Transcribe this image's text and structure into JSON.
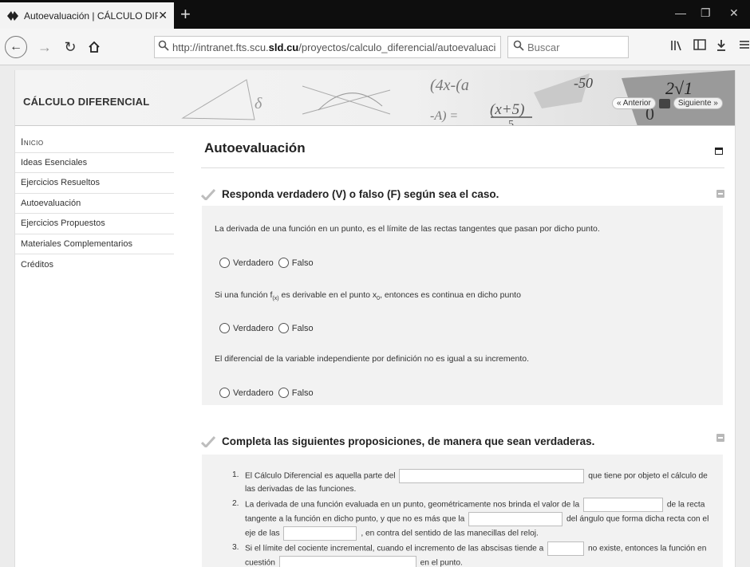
{
  "browser": {
    "tab_title": "Autoevaluación | CÁLCULO DIF",
    "close_symbol": "✕",
    "new_tab_symbol": "+",
    "url_prefix": "http://intranet.fts.scu.",
    "url_domain": "sld.cu",
    "url_path": "/proyectos/calculo_diferencial/autoevaluaci",
    "search_placeholder": "Buscar"
  },
  "site": {
    "title": "CÁLCULO DIFERENCIAL",
    "prev_label": "« Anterior",
    "next_label": "Siguiente »"
  },
  "sidebar": {
    "items": [
      {
        "label": "Inicio"
      },
      {
        "label": "Ideas Esenciales"
      },
      {
        "label": "Ejercicios Resueltos"
      },
      {
        "label": "Autoevaluación"
      },
      {
        "label": "Ejercicios Propuestos"
      },
      {
        "label": "Materiales Complementarios"
      },
      {
        "label": "Créditos"
      }
    ]
  },
  "content": {
    "title": "Autoevaluación",
    "section1": {
      "title": "Responda verdadero (V) o falso (F) según sea el caso.",
      "questions": [
        {
          "text": "La derivada de una función en un punto, es el límite de las rectas tangentes que pasan por dicho punto."
        },
        {
          "text_a": "Si una función f",
          "sub_a": "(x)",
          "text_b": " es derivable en el punto x",
          "sub_b": "0",
          "text_c": ", entonces es continua en dicho punto"
        },
        {
          "text": "El diferencial de la variable independiente por definición no es igual a su incremento."
        }
      ],
      "option_true": "Verdadero",
      "option_false": "Falso"
    },
    "section2": {
      "title": "Completa las siguientes proposiciones, de manera que sean verdaderas.",
      "items": [
        {
          "num": "1.",
          "a": "El Cálculo Diferencial es aquella parte del",
          "b": "que tiene por objeto el cálculo de las derivadas de las funciones."
        },
        {
          "num": "2.",
          "a": "La derivada de una función evaluada en un punto, geométricamente nos brinda el valor de la",
          "b": "de la recta tangente a la función en dicho punto, y que no es más que la",
          "c": "del ángulo que forma dicha recta con el eje de las",
          "d": ", en contra del sentido de las manecillas del reloj."
        },
        {
          "num": "3.",
          "a": "Si el límite del cociente incremental, cuando el incremento de las abscisas tiende a",
          "b": "no existe, entonces la función en cuestión",
          "c": "en el punto."
        }
      ]
    }
  }
}
